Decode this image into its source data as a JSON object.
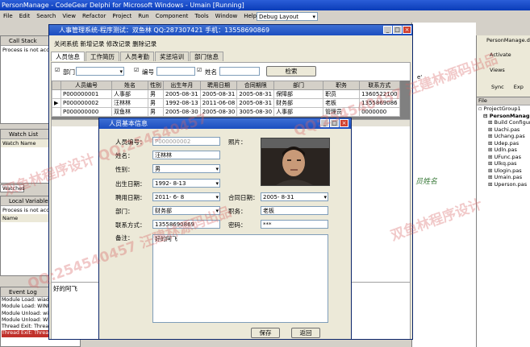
{
  "ide": {
    "title": "PersonManage - CodeGear Delphi for Microsoft Windows - Umain [Running]",
    "menu": [
      "File",
      "Edit",
      "Search",
      "View",
      "Refactor",
      "Project",
      "Run",
      "Component",
      "Tools",
      "Window",
      "Help"
    ],
    "layout_select": "Debug Layout",
    "call_stack": {
      "title": "Call Stack",
      "text": "Process is not accessible"
    },
    "watch_list": {
      "title": "Watch List",
      "col": "Watch Name"
    },
    "watches_tab": "Watches",
    "local_vars": {
      "title": "Local Variables",
      "text": "Process is not accessible",
      "col": "Name"
    },
    "event_log": {
      "title": "Event Log",
      "lines": [
        "Module Load: wiadefui.dll",
        "Module Load: WINMM.dll",
        "Module Unload: wiadefui.dll",
        "Module Unload: WINMM.dll",
        "Thread Exit: Thread ID: 6164. Process Person",
        "Thread Exit: Thread ID: 7736. Process Person"
      ]
    },
    "right": {
      "file": "PersonManage.dproj",
      "activate": "Activate",
      "views": "Views",
      "sync": "Sync",
      "exp": "Exp",
      "file_col": "File",
      "group": "ProjectGroup1",
      "project": "PersonManage.exe",
      "items": [
        "Build Configurations",
        "Uachi.pas",
        "Uchang.pas",
        "Udep.pas",
        "Udln.pas",
        "UFunc.pas",
        "Ulkq.pas",
        "Ulogin.pas",
        "Umain.pas",
        "Uperson.pas"
      ]
    },
    "code_fragment": "员姓名",
    "code_fragment2": "e'"
  },
  "main_win": {
    "title": "人事管理系统-程序测试：双鱼林 QQ:287307421 手机：13558690869",
    "menu": [
      "关闭系统",
      "新增记录",
      "修改记录",
      "删除记录"
    ],
    "tabs": [
      "人员信息",
      "工作简历",
      "人员考勤",
      "奖惩培训",
      "部门信息"
    ],
    "filter": {
      "dept": "部门",
      "num": "编号",
      "name": "姓名",
      "search": "检索"
    },
    "columns": [
      "人员编号",
      "姓名",
      "性别",
      "出生年月",
      "聘用日期",
      "合同期限",
      "部门",
      "职务",
      "联系方式"
    ],
    "rows": [
      [
        "P000000001",
        "人事部",
        "男",
        "2005-08-31",
        "2005-08-31",
        "2005-08-31",
        "保障部",
        "职员",
        "1360522100"
      ],
      [
        "P000000002",
        "汪林林",
        "男",
        "1992-08-13",
        "2011-06-08",
        "2005-08-31",
        "财务部",
        "老板",
        "1355869086"
      ],
      [
        "P000000000",
        "双鱼林",
        "男",
        "2005-08-30",
        "2005-08-30",
        "3005-08-30",
        "人事部",
        "管理员",
        "0000000"
      ]
    ],
    "memo": "好的阿飞"
  },
  "dlg": {
    "title": "人员基本信息",
    "num_label": "人员编号：",
    "num_value": "P000000002",
    "photo_label": "照片：",
    "name_label": "姓名：",
    "name_value": "汪林林",
    "sex_label": "性别：",
    "sex_value": "男",
    "birth_label": "出生日期：",
    "birth_value": "1992- 8-13",
    "hire_label": "聘用日期：",
    "hire_value": "2011- 6- 8",
    "contract_label": "合同日期：",
    "contract_value": "2005- 8-31",
    "dept_label": "部门：",
    "dept_value": "财务部",
    "duty_label": "职务：",
    "duty_value": "老板",
    "phone_label": "联系方式：",
    "phone_value": "13558690869",
    "pwd_label": "密码：",
    "pwd_value": "***",
    "note_label": "备注：",
    "note_value": "好的阿飞",
    "save": "保存",
    "back": "返回"
  },
  "watermarks": [
    "QQ:254540457 汪建林源码出品",
    "双鱼林程序设计 QQ:254540457",
    "QQ:254540457 汪建林源码出品",
    "双鱼林程序设计"
  ],
  "colors": {
    "title": "#1c4ec0",
    "window_bg": "#ece9d8",
    "ide_bg": "#d4d0c8"
  }
}
